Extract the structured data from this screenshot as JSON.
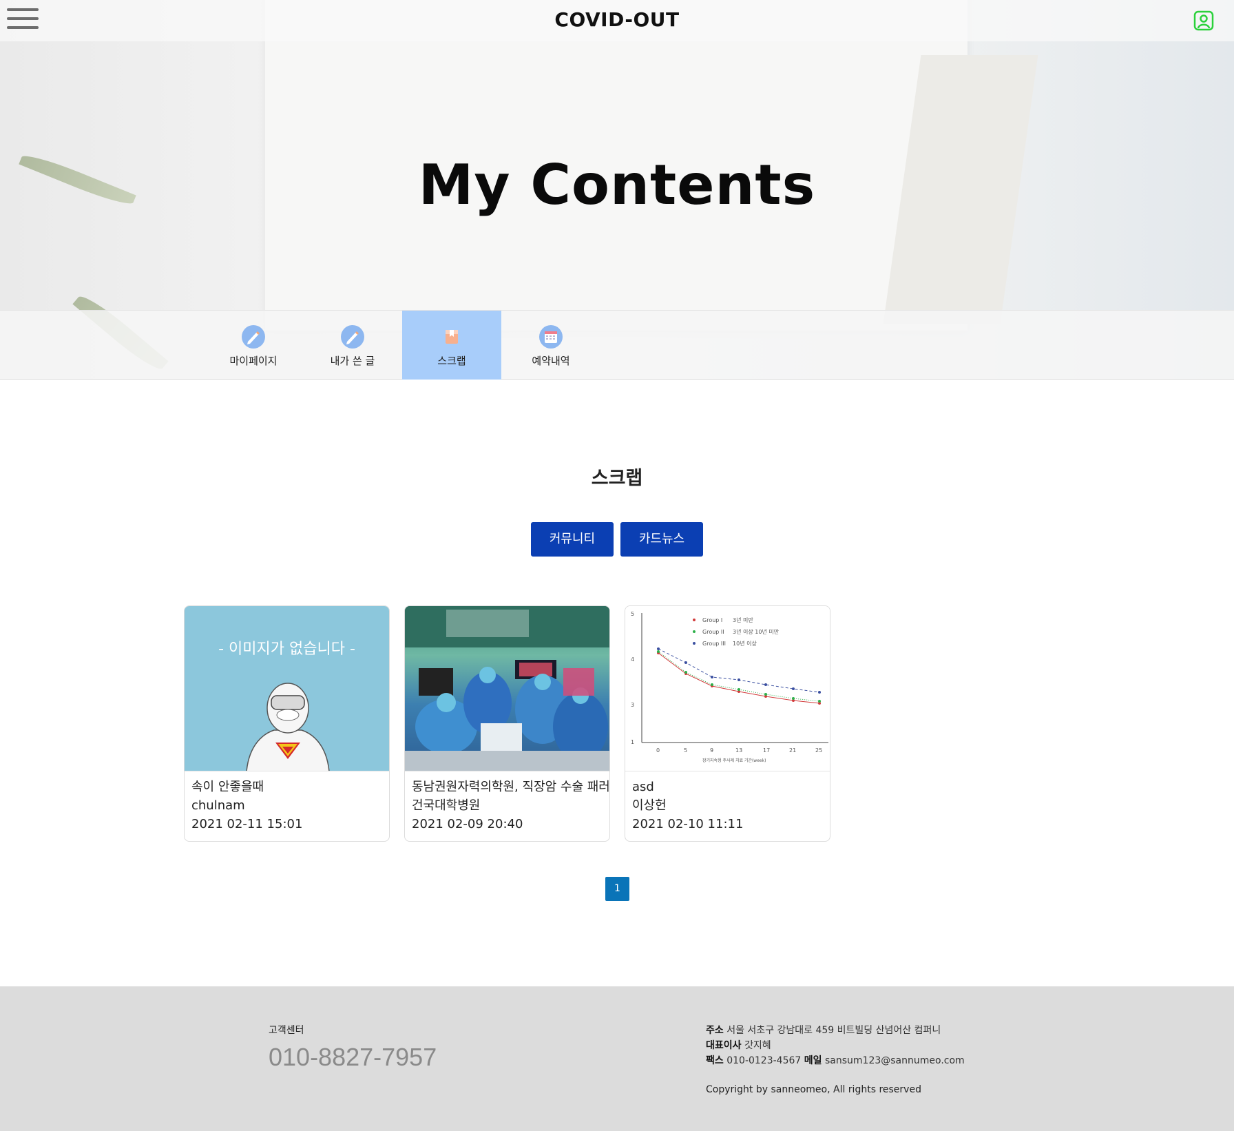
{
  "header": {
    "logo": "COVID-OUT"
  },
  "hero": {
    "title": "My Contents"
  },
  "tabs": [
    {
      "label": "마이페이지",
      "icon": "pencil-icon",
      "active": false
    },
    {
      "label": "내가 쓴 글",
      "icon": "pencil-icon",
      "active": false
    },
    {
      "label": "스크랩",
      "icon": "bookmark-icon",
      "active": true
    },
    {
      "label": "예약내역",
      "icon": "calendar-icon",
      "active": false
    }
  ],
  "main": {
    "section_title": "스크랩",
    "category_buttons": [
      "커뮤니티",
      "카드뉴스"
    ],
    "cards": [
      {
        "title": "속이 안좋을때",
        "author": "chulnam",
        "date": "2021 02-11 15:01",
        "image_text": "- 이미지가 없습니다 -"
      },
      {
        "title": "동남권원자력의학원, 직장암 수술 패러다",
        "author": "건국대학병원",
        "date": "2021 02-09 20:40"
      },
      {
        "title": "asd",
        "author": "이상헌",
        "date": "2021 02-10 11:11"
      }
    ],
    "pagination": [
      "1"
    ]
  },
  "chart_thumb": {
    "legend": [
      "Group I",
      "3년 미만",
      "Group II",
      "3년 이상 10년 미만",
      "Group III",
      "10년 이상"
    ],
    "x_ticks": [
      "0",
      "5",
      "9",
      "13",
      "17",
      "21",
      "25"
    ],
    "y_ticks": [
      "5",
      "4",
      "3",
      "1"
    ],
    "xlabel": "장기지속형 주사제 치료 기간(week)"
  },
  "footer": {
    "cs_label": "고객센터",
    "cs_phone": "010-8827-7957",
    "address_label": "주소",
    "address": "서울 서초구 강남대로 459 비트빌딩 산넘어산 컴퍼니",
    "ceo_label": "대표이사",
    "ceo": "갓지혜",
    "fax_label": "팩스",
    "fax": "010-0123-4567",
    "mail_label": "메일",
    "mail": "sansum123@sannumeo.com",
    "copyright": "Copyright by sanneomeo, All rights reserved"
  },
  "colors": {
    "accent_button": "#0b3fb3",
    "active_tab": "#a8cdfa",
    "pager": "#0a74b8",
    "user_icon": "#2bd13b",
    "footer_bg": "#dcdcdc"
  }
}
